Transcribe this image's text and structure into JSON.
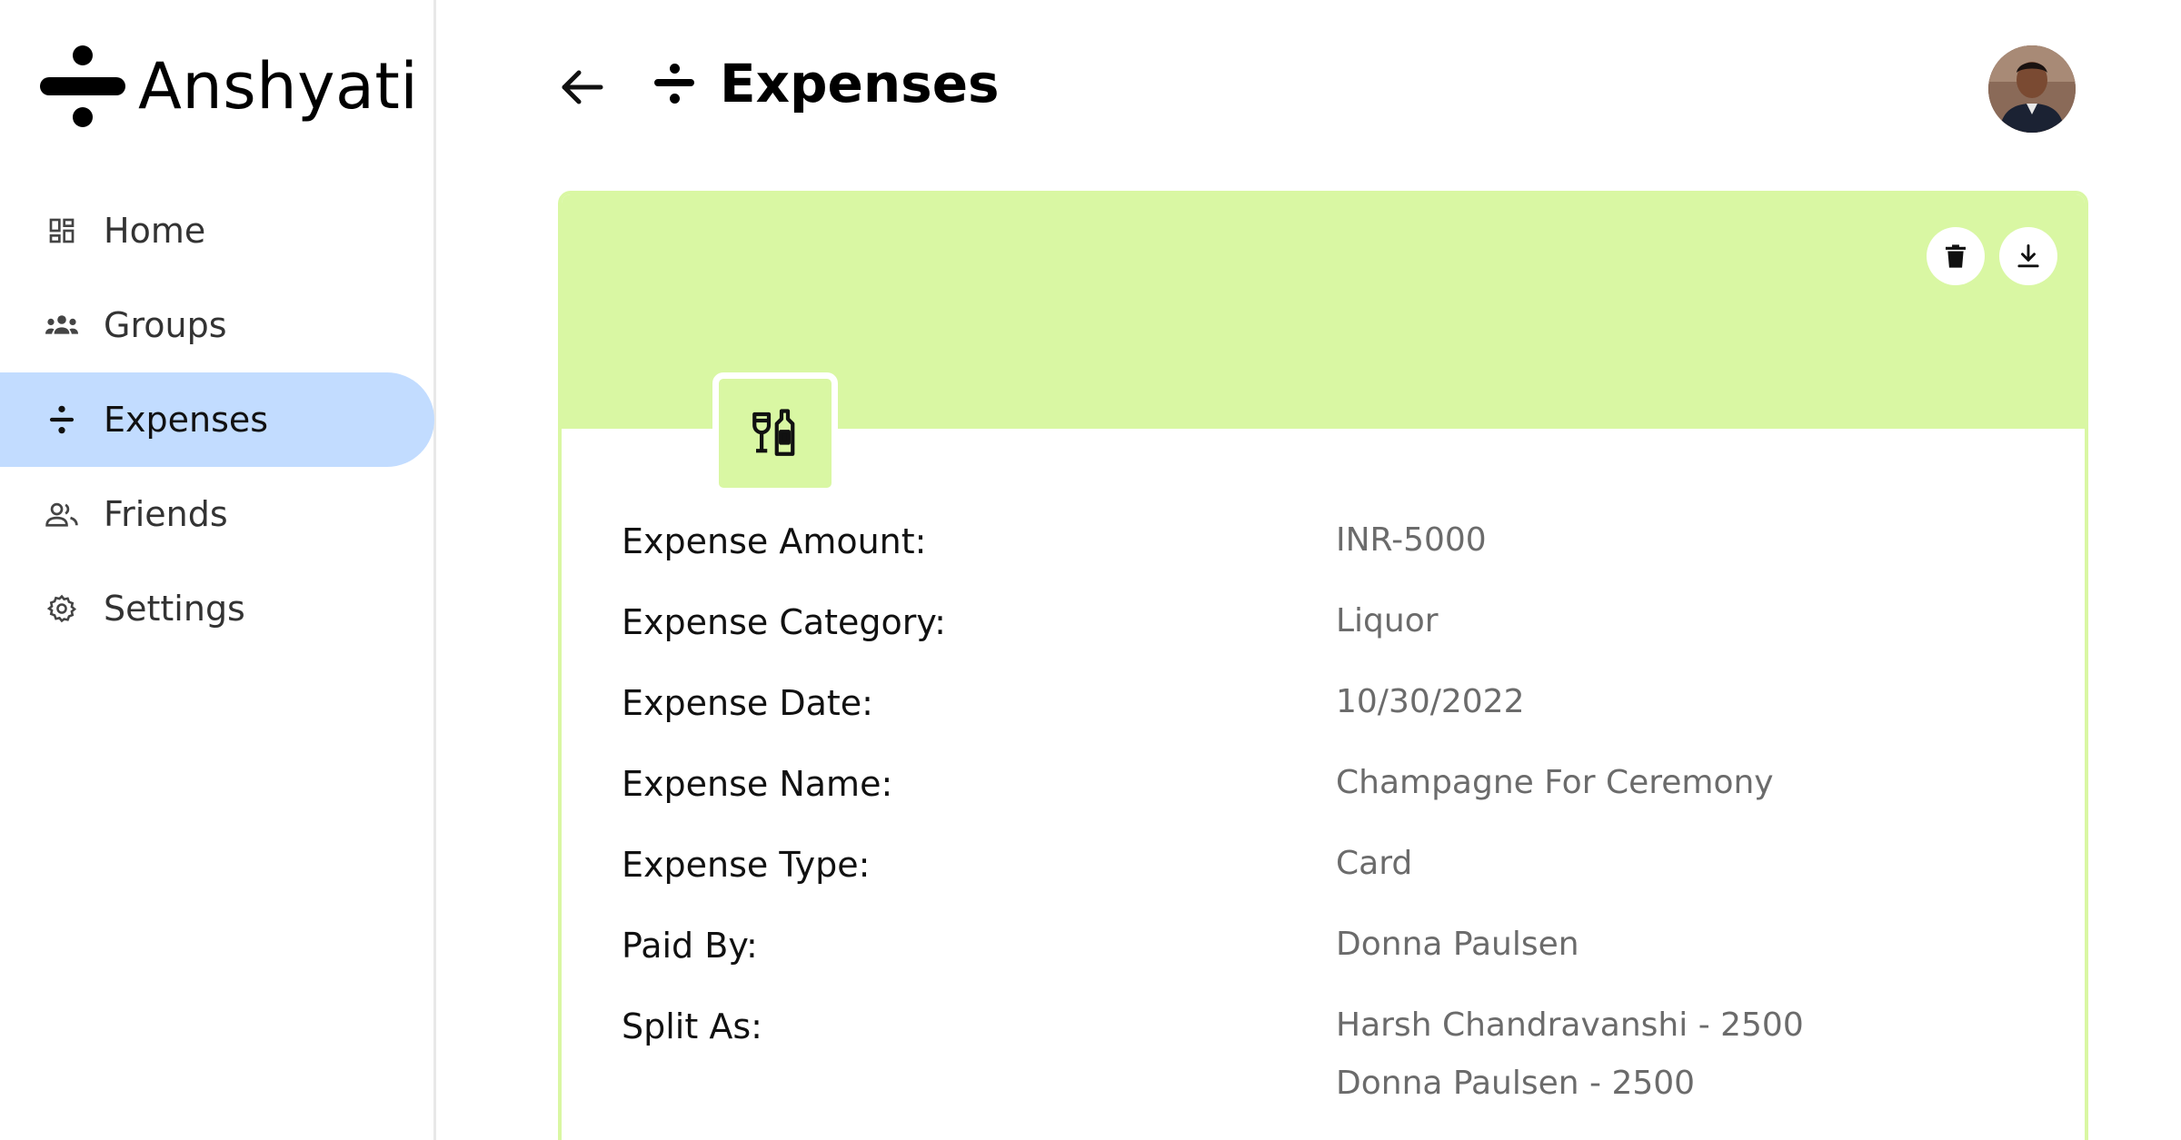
{
  "app": {
    "name": "Anshyati"
  },
  "sidebar": {
    "items": [
      {
        "label": "Home",
        "icon": "dashboard-icon"
      },
      {
        "label": "Groups",
        "icon": "groups-icon"
      },
      {
        "label": "Expenses",
        "icon": "divide-icon",
        "active": true
      },
      {
        "label": "Friends",
        "icon": "friends-icon"
      },
      {
        "label": "Settings",
        "icon": "gear-icon"
      }
    ]
  },
  "header": {
    "title": "Expenses"
  },
  "colors": {
    "accent": "#d9f7a3",
    "active_nav": "#c2dcff",
    "value_text": "#6b6b6b"
  },
  "expense": {
    "fields": [
      {
        "label": "Expense Amount:",
        "value": "INR-5000"
      },
      {
        "label": "Expense Category:",
        "value": "Liquor"
      },
      {
        "label": "Expense Date:",
        "value": "10/30/2022"
      },
      {
        "label": "Expense Name:",
        "value": "Champagne For Ceremony"
      },
      {
        "label": "Expense Type:",
        "value": "Card"
      },
      {
        "label": "Paid By:",
        "value": "Donna Paulsen"
      }
    ],
    "split": {
      "label": "Split As:",
      "values": [
        "Harsh Chandravanshi - 2500",
        "Donna Paulsen - 2500"
      ]
    }
  }
}
